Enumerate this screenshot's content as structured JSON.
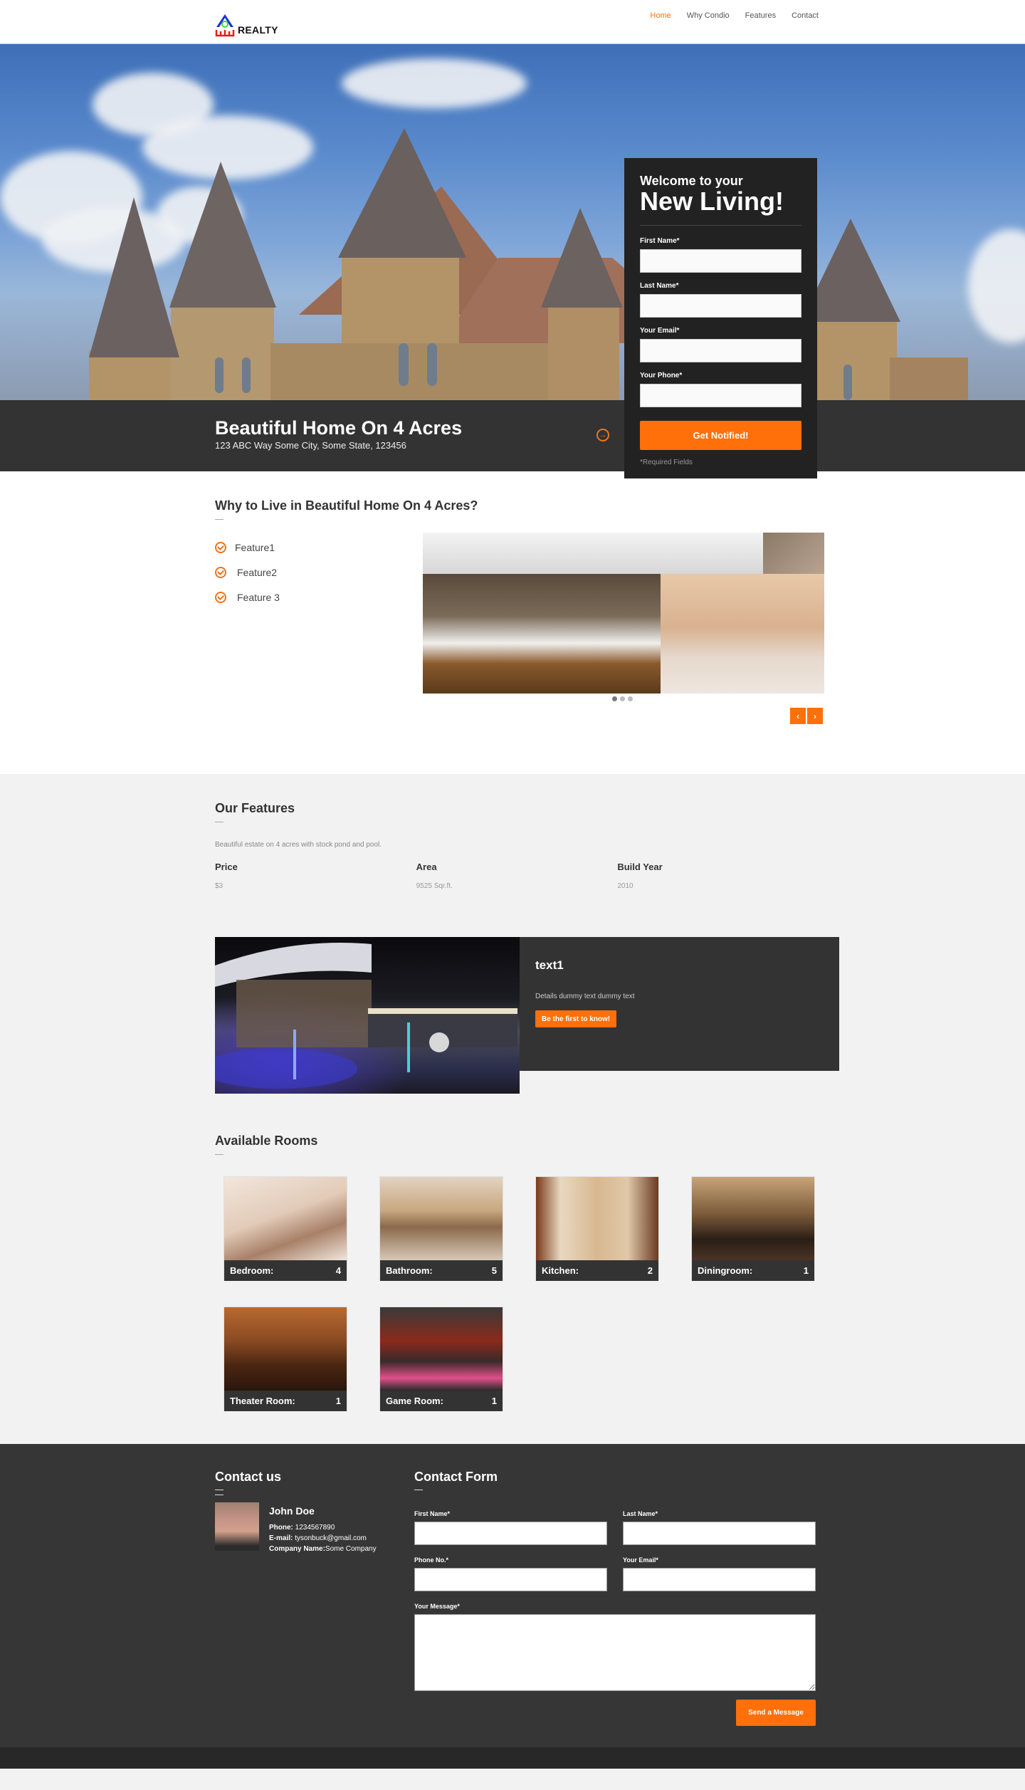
{
  "header": {
    "logo_text": "REALTY",
    "nav": [
      {
        "label": "Home",
        "active": true
      },
      {
        "label": "Why Condio",
        "active": false
      },
      {
        "label": "Features",
        "active": false
      },
      {
        "label": "Contact",
        "active": false
      }
    ]
  },
  "hero": {
    "title": "Beautiful Home On 4 Acres",
    "address": "123 ABC Way Some City, Some State, 123456",
    "arrow_icon": "arrow-circle-right-icon"
  },
  "signup": {
    "welcome": "Welcome to your",
    "headline": "New Living!",
    "fields": [
      {
        "label": "First Name*",
        "value": ""
      },
      {
        "label": "Last Name*",
        "value": ""
      },
      {
        "label": "Your Email*",
        "value": ""
      },
      {
        "label": "Your Phone*",
        "value": ""
      }
    ],
    "submit_label": "Get Notified!",
    "required_note": "*Required Fields"
  },
  "why": {
    "title": "Why to Live in Beautiful Home On 4 Acres?",
    "features": [
      "Feature1",
      "Feature2",
      "Feature 3"
    ],
    "slider": {
      "slide_count": 3,
      "active_slide": 1,
      "prev_label": "‹",
      "next_label": "›"
    }
  },
  "our_features": {
    "title": "Our Features",
    "description": "Beautiful estate on 4 acres with stock pond and pool.",
    "stats": [
      {
        "label": "Price",
        "value": "$3"
      },
      {
        "label": "Area",
        "value": "9525 Sqr.ft."
      },
      {
        "label": "Build Year",
        "value": "2010"
      }
    ]
  },
  "promo": {
    "title": "text1",
    "details": "Details dummy text dummy text",
    "button_label": "Be the first to know!"
  },
  "rooms": {
    "title": "Available Rooms",
    "items": [
      {
        "name": "Bedroom:",
        "count": "4"
      },
      {
        "name": "Bathroom:",
        "count": "5"
      },
      {
        "name": "Kitchen:",
        "count": "2"
      },
      {
        "name": "Diningroom:",
        "count": "1"
      },
      {
        "name": "Theater Room:",
        "count": "1"
      },
      {
        "name": "Game Room:",
        "count": "1"
      }
    ]
  },
  "contact": {
    "title": "Contact us",
    "name": "John Doe",
    "phone_label": "Phone:",
    "phone": " 1234567890",
    "email_label": "E-mail:",
    "email": " tysonbuck@gmail.com",
    "company_label": "Company Name:",
    "company": "Some Company"
  },
  "contact_form": {
    "title": "Contact Form",
    "fields": [
      {
        "label": "First Name*",
        "value": ""
      },
      {
        "label": "Last Name*",
        "value": ""
      },
      {
        "label": "Phone No.*",
        "value": ""
      },
      {
        "label": "Your Email*",
        "value": ""
      }
    ],
    "message_label": "Your Message*",
    "message_value": "",
    "submit_label": "Send a Message"
  },
  "colors": {
    "accent": "#ff6f0a",
    "dark_panel": "#333333",
    "signup_bg": "#222222",
    "page_bg": "#f2f2f2"
  }
}
